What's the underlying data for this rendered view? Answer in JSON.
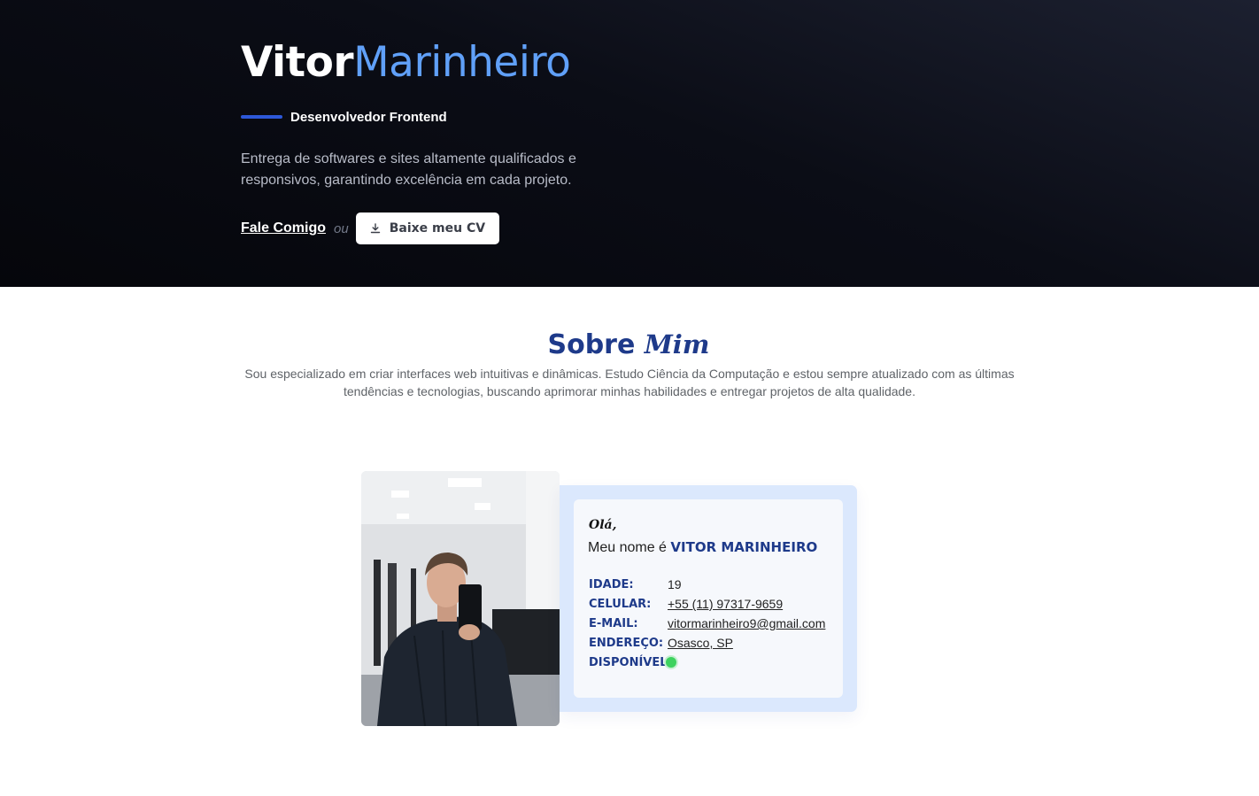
{
  "hero": {
    "name_first": "Vitor",
    "name_last": "Marinheiro",
    "role": "Desenvolvedor Frontend",
    "tagline": "Entrega de softwares e sites altamente qualificados e responsivos, garantindo excelência em cada projeto.",
    "contact_label": "Fale Comigo",
    "or_label": "ou",
    "cv_label": "Baixe meu CV",
    "cv_icon": "download-icon"
  },
  "about": {
    "title_part1": "Sobre",
    "title_part2": "Mim",
    "text": "Sou especializado em criar interfaces web intuitivas e dinâmicas. Estudo Ciência da Computação e estou sempre atualizado com as últimas tendências e tecnologias, buscando aprimorar minhas habilidades e entregar projetos de alta qualidade."
  },
  "profile": {
    "greeting": "Olá,",
    "intro_prefix": "Meu nome é",
    "intro_name": "VITOR MARINHEIRO",
    "age_label": "IDADE:",
    "age_value": "19",
    "phone_label": "CELULAR:",
    "phone_value": "+55 (11) 97317-9659",
    "email_label": "E-MAIL:",
    "email_value": "vitormarinheiro9@gmail.com",
    "address_label": "ENDEREÇO:",
    "address_value": "Osasco, SP",
    "available_label": "DISPONÍVEL:",
    "available_color": "#3dd25f"
  },
  "colors": {
    "accent": "#60a0f8",
    "brand_navy": "#1e3a8a",
    "hero_bg": "#05060b",
    "card_bg": "#dbe8fd"
  }
}
